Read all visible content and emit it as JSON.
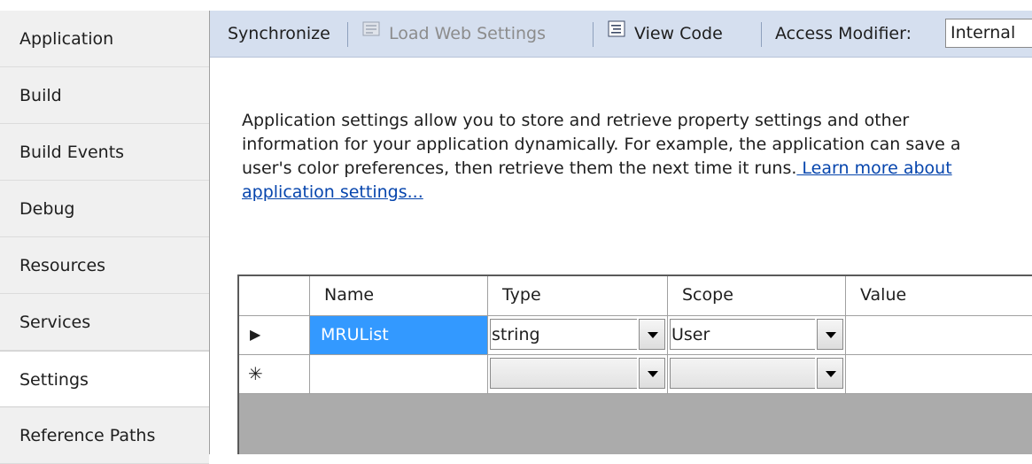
{
  "sidebar": {
    "items": [
      {
        "label": "Application"
      },
      {
        "label": "Build"
      },
      {
        "label": "Build Events"
      },
      {
        "label": "Debug"
      },
      {
        "label": "Resources"
      },
      {
        "label": "Services"
      },
      {
        "label": "Settings",
        "active": true
      },
      {
        "label": "Reference Paths"
      }
    ]
  },
  "toolbar": {
    "synchronize_label": "Synchronize",
    "load_web_settings_label": "Load Web Settings",
    "view_code_label": "View Code",
    "access_modifier_label": "Access Modifier:",
    "access_modifier_value": "Internal"
  },
  "description": {
    "line1": "Application settings allow you to store and retrieve property settings and other",
    "line2": "information for your application dynamically. For example, the application can save a",
    "line3": "user's color preferences, then retrieve them the next time it runs.",
    "link_part1": " Learn more about",
    "link_part2": "application settings..."
  },
  "grid": {
    "columns": [
      "Name",
      "Type",
      "Scope",
      "Value"
    ],
    "rows": [
      {
        "indicator": "▶",
        "name": "MRUList",
        "type": "string",
        "scope": "User",
        "value": ""
      },
      {
        "indicator": "✳",
        "name": "",
        "type": "",
        "scope": "",
        "value": ""
      }
    ]
  }
}
